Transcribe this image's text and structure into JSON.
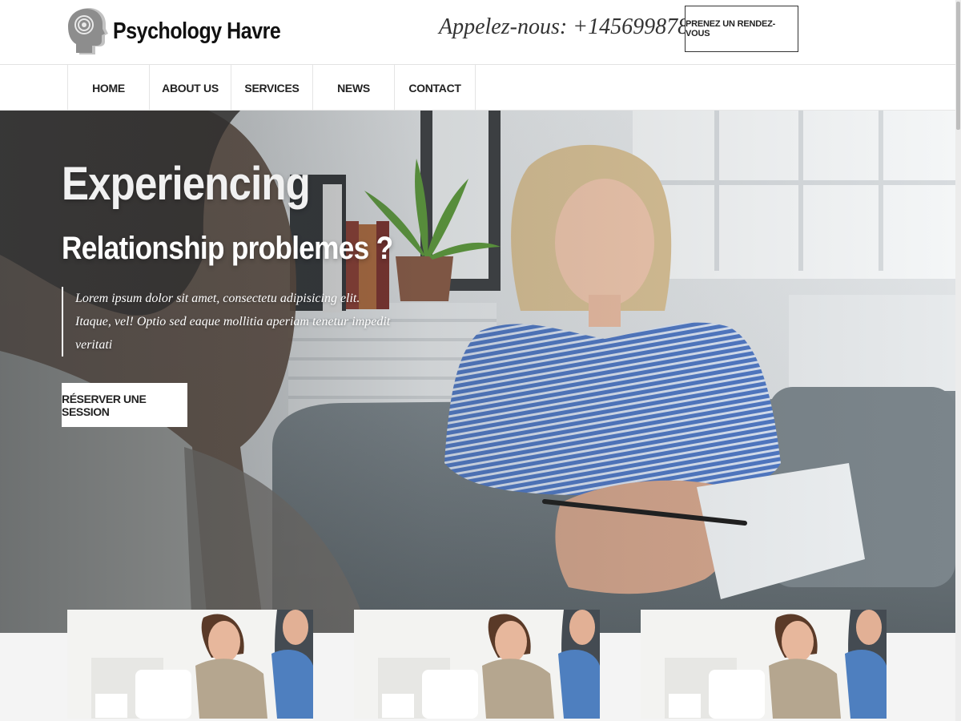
{
  "header": {
    "brand": "Psychology Havre",
    "phone": "Appelez-nous: +145699878",
    "appointment_button": "PRENEZ UN RENDEZ-VOUS"
  },
  "nav": {
    "items": [
      {
        "label": "HOME"
      },
      {
        "label": "ABOUT US"
      },
      {
        "label": "SERVICES"
      },
      {
        "label": "NEWS"
      },
      {
        "label": "CONTACT"
      }
    ]
  },
  "hero": {
    "title_line1": "Experiencing",
    "title_line2": "Relationship problemes ?",
    "lead_line1": "Lorem ipsum dolor sit amet, consectetu adipisicing elit.",
    "lead_line2": "Itaque, vel! Optio sed eaque mollitia aperiam tenetur impedit veritati",
    "cta_button": "RÉSERVER UNE SESSION"
  },
  "colors": {
    "header_bg": "#ffffff",
    "hero_overlay_text": "#ffffff",
    "button_bg": "#ffffff",
    "page_bg": "#f4f4f4"
  },
  "icons": {
    "logo": "head-spiral-icon"
  }
}
